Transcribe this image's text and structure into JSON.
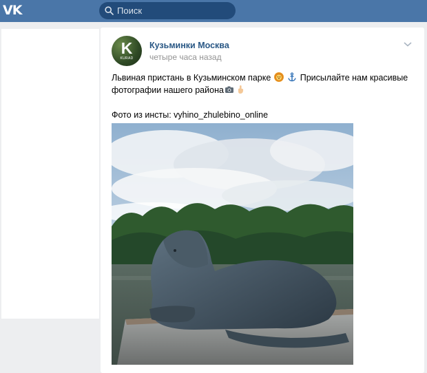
{
  "header": {
    "logo_text": "VK",
    "search_placeholder": "Поиск",
    "bar_color": "#4a76a8"
  },
  "post": {
    "author": "Кузьминки Москва",
    "time": "четыре часа назад",
    "avatar": {
      "letter": "K",
      "sub": "KURAD"
    },
    "text_line1": "Львиная пристань в Кузьминском парке",
    "text_line1b": "Присылайте нам красивые",
    "text_line2": "фотографии нашего района",
    "source": "Фото из инсты: vyhino_zhulebino_online",
    "icons": [
      "lion-emoji",
      "anchor-emoji",
      "camera-emoji",
      "pointing-hand-emoji",
      "chevron-down-icon"
    ],
    "link_color": "#2a5885"
  }
}
